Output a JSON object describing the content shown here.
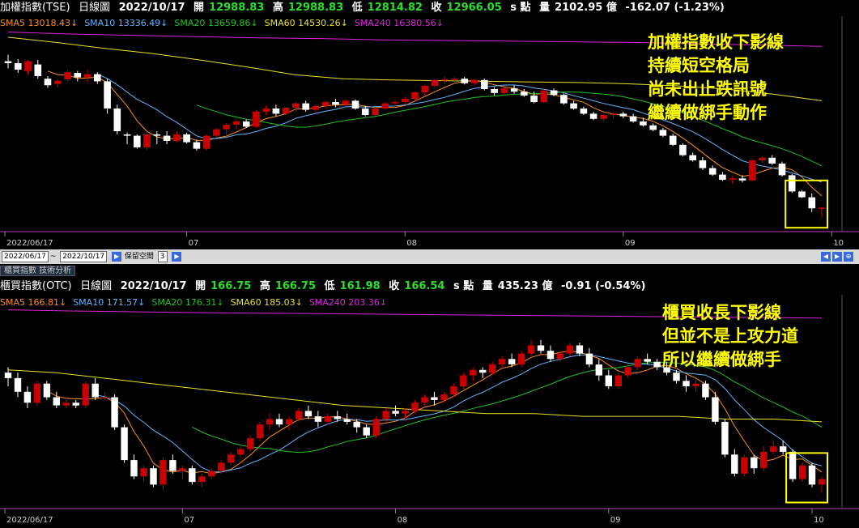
{
  "top": {
    "name": "加權指數(TSE)",
    "period": "日線圖",
    "date": "2022/10/17",
    "open_label": "開",
    "open": "12988.83",
    "high_label": "高",
    "high": "12988.83",
    "low_label": "低",
    "low": "12814.82",
    "close_label": "收",
    "close": "12966.05",
    "unit_label": "s 點",
    "vol_label": "量",
    "volume": "2102.95 億",
    "change": "-162.07 (-1.23%)",
    "legend": [
      {
        "label": "SMA5 13018.43",
        "color": "#ff8c1a"
      },
      {
        "label": "SMA10 13336.49",
        "color": "#5fb4ff"
      },
      {
        "label": "SMA20 13659.86",
        "color": "#22c022"
      },
      {
        "label": "SMA60 14530.26",
        "color": "#e8e020"
      },
      {
        "label": "SMA240 16380.56",
        "color": "#e020e0"
      }
    ],
    "annotation": [
      "加權指數收下影線",
      "持續短空格局",
      "尚未出止跌訊號",
      "繼續做綁手動作"
    ]
  },
  "bottom": {
    "name": "櫃買指數(OTC)",
    "period": "日線圖",
    "date": "2022/10/17",
    "open_label": "開",
    "open": "166.75",
    "high_label": "高",
    "high": "166.75",
    "low_label": "低",
    "low": "161.98",
    "close_label": "收",
    "close": "166.54",
    "unit_label": "s 點",
    "vol_label": "量",
    "volume": "435.23 億",
    "change": "-0.91 (-0.54%)",
    "legend": [
      {
        "label": "SMA5 166.81",
        "color": "#ff8c1a"
      },
      {
        "label": "SMA10 171.57",
        "color": "#5fb4ff"
      },
      {
        "label": "SMA20 176.31",
        "color": "#22c022"
      },
      {
        "label": "SMA60 185.03",
        "color": "#e8e020"
      },
      {
        "label": "SMA240 203.36",
        "color": "#e020e0"
      }
    ],
    "annotation": [
      "櫃買收長下影線",
      "但並不是上攻力道",
      "所以繼續做綁手"
    ]
  },
  "x_axis": [
    "2022/06/17",
    "07",
    "08",
    "09",
    "10"
  ],
  "toolbar": {
    "start": "2022/06/17",
    "end": "2022/10/17",
    "keep_label": "保留空間",
    "keep_value": "3"
  },
  "tab": {
    "label": "櫃買指數 技術分析"
  },
  "colors": {
    "up": "#c80000",
    "down": "#ffffff",
    "border": "#ffff00"
  },
  "chart_data": [
    {
      "type": "candlestick",
      "title": "加權指數(TSE)",
      "ylim": [
        12700,
        15700
      ],
      "ohlc": [
        [
          15230,
          15330,
          15120,
          15200
        ],
        [
          15200,
          15260,
          15050,
          15100
        ],
        [
          15080,
          15250,
          15020,
          15230
        ],
        [
          15180,
          15250,
          14960,
          15000
        ],
        [
          14960,
          15000,
          14820,
          14860
        ],
        [
          14880,
          14950,
          14820,
          14930
        ],
        [
          14950,
          15100,
          14920,
          15060
        ],
        [
          15050,
          15080,
          14920,
          14980
        ],
        [
          14980,
          15100,
          14900,
          15030
        ],
        [
          15030,
          15060,
          14880,
          14920
        ],
        [
          14920,
          14960,
          14420,
          14500
        ],
        [
          14500,
          14560,
          14100,
          14150
        ],
        [
          14100,
          14130,
          13950,
          14080
        ],
        [
          14080,
          14100,
          13880,
          13900
        ],
        [
          13900,
          14130,
          13860,
          14100
        ],
        [
          14100,
          14150,
          13950,
          14080
        ],
        [
          14080,
          14150,
          13950,
          14000
        ],
        [
          14000,
          14150,
          13980,
          14100
        ],
        [
          14100,
          14130,
          13960,
          13980
        ],
        [
          13980,
          14020,
          13850,
          13880
        ],
        [
          13880,
          14100,
          13850,
          14080
        ],
        [
          14080,
          14200,
          14050,
          14180
        ],
        [
          14180,
          14280,
          14100,
          14250
        ],
        [
          14250,
          14330,
          14180,
          14300
        ],
        [
          14300,
          14330,
          14200,
          14220
        ],
        [
          14220,
          14480,
          14200,
          14450
        ],
        [
          14450,
          14550,
          14400,
          14500
        ],
        [
          14500,
          14560,
          14380,
          14420
        ],
        [
          14420,
          14520,
          14400,
          14510
        ],
        [
          14510,
          14600,
          14450,
          14580
        ],
        [
          14580,
          14620,
          14450,
          14480
        ],
        [
          14480,
          14560,
          14440,
          14540
        ],
        [
          14540,
          14620,
          14500,
          14600
        ],
        [
          14600,
          14650,
          14520,
          14560
        ],
        [
          14560,
          14640,
          14540,
          14620
        ],
        [
          14620,
          14640,
          14480,
          14500
        ],
        [
          14500,
          14540,
          14380,
          14400
        ],
        [
          14400,
          14520,
          14380,
          14500
        ],
        [
          14500,
          14600,
          14480,
          14580
        ],
        [
          14580,
          14620,
          14520,
          14600
        ],
        [
          14600,
          14680,
          14560,
          14650
        ],
        [
          14650,
          14760,
          14620,
          14750
        ],
        [
          14750,
          14860,
          14700,
          14850
        ],
        [
          14850,
          14960,
          14820,
          14940
        ],
        [
          14940,
          15000,
          14880,
          14950
        ],
        [
          14950,
          14990,
          14900,
          14960
        ],
        [
          14960,
          14990,
          14870,
          14890
        ],
        [
          14890,
          14960,
          14850,
          14940
        ],
        [
          14940,
          14960,
          14780,
          14800
        ],
        [
          14800,
          14830,
          14700,
          14740
        ],
        [
          14740,
          14830,
          14720,
          14810
        ],
        [
          14810,
          14860,
          14730,
          14760
        ],
        [
          14760,
          14800,
          14680,
          14700
        ],
        [
          14700,
          14760,
          14580,
          14600
        ],
        [
          14600,
          14800,
          14580,
          14780
        ],
        [
          14780,
          14810,
          14690,
          14710
        ],
        [
          14710,
          14730,
          14560,
          14580
        ],
        [
          14580,
          14620,
          14480,
          14500
        ],
        [
          14500,
          14530,
          14400,
          14420
        ],
        [
          14420,
          14450,
          14320,
          14340
        ],
        [
          14340,
          14420,
          14300,
          14400
        ],
        [
          14400,
          14440,
          14340,
          14420
        ],
        [
          14420,
          14450,
          14350,
          14380
        ],
        [
          14380,
          14420,
          14280,
          14300
        ],
        [
          14300,
          14360,
          14220,
          14240
        ],
        [
          14240,
          14270,
          14150,
          14170
        ],
        [
          14170,
          14200,
          14060,
          14080
        ],
        [
          14080,
          14110,
          13920,
          13940
        ],
        [
          13940,
          13960,
          13760,
          13780
        ],
        [
          13780,
          13820,
          13680,
          13700
        ],
        [
          13700,
          13750,
          13550,
          13580
        ],
        [
          13580,
          13620,
          13460,
          13480
        ],
        [
          13480,
          13520,
          13380,
          13400
        ],
        [
          13400,
          13460,
          13340,
          13420
        ],
        [
          13420,
          13470,
          13360,
          13390
        ],
        [
          13390,
          13720,
          13370,
          13700
        ],
        [
          13700,
          13760,
          13660,
          13740
        ],
        [
          13740,
          13780,
          13630,
          13650
        ],
        [
          13650,
          13680,
          13450,
          13470
        ],
        [
          13470,
          13490,
          13200,
          13220
        ],
        [
          13220,
          13240,
          13120,
          13130
        ],
        [
          13130,
          13190,
          12900,
          12960
        ],
        [
          12960,
          12980,
          12810,
          12970
        ]
      ]
    },
    {
      "type": "candlestick",
      "title": "櫃買指數(OTC)",
      "ylim": [
        158,
        228
      ],
      "ohlc": [
        [
          206,
          208,
          201,
          204
        ],
        [
          204,
          206,
          197,
          199
        ],
        [
          199,
          201,
          193,
          195
        ],
        [
          195,
          203,
          194,
          202
        ],
        [
          202,
          203,
          196,
          197
        ],
        [
          197,
          199,
          193,
          194
        ],
        [
          194,
          197,
          193,
          195
        ],
        [
          195,
          196,
          193,
          194
        ],
        [
          194,
          203,
          193,
          202
        ],
        [
          202,
          204,
          196,
          197
        ],
        [
          197,
          199,
          196,
          197
        ],
        [
          197,
          198,
          185,
          186
        ],
        [
          186,
          187,
          173,
          174
        ],
        [
          174,
          176,
          167,
          168
        ],
        [
          168,
          172,
          166,
          171
        ],
        [
          171,
          172,
          164,
          165
        ],
        [
          165,
          175,
          163,
          174
        ],
        [
          174,
          176,
          169,
          170
        ],
        [
          170,
          172,
          167,
          171
        ],
        [
          171,
          172,
          165,
          166
        ],
        [
          166,
          169,
          164,
          168
        ],
        [
          168,
          171,
          167,
          170
        ],
        [
          170,
          174,
          169,
          173
        ],
        [
          173,
          177,
          172,
          176
        ],
        [
          176,
          179,
          175,
          178
        ],
        [
          178,
          183,
          177,
          182
        ],
        [
          182,
          188,
          181,
          187
        ],
        [
          187,
          191,
          185,
          189
        ],
        [
          189,
          191,
          186,
          187
        ],
        [
          187,
          190,
          185,
          189
        ],
        [
          189,
          193,
          188,
          192
        ],
        [
          192,
          194,
          189,
          190
        ],
        [
          190,
          192,
          186,
          188
        ],
        [
          188,
          191,
          187,
          190
        ],
        [
          190,
          192,
          188,
          189
        ],
        [
          189,
          191,
          187,
          188
        ],
        [
          188,
          189,
          184,
          186
        ],
        [
          186,
          187,
          182,
          183
        ],
        [
          183,
          190,
          182,
          189
        ],
        [
          189,
          193,
          188,
          192
        ],
        [
          192,
          194,
          190,
          191
        ],
        [
          191,
          193,
          189,
          192
        ],
        [
          192,
          196,
          191,
          195
        ],
        [
          195,
          198,
          194,
          197
        ],
        [
          197,
          199,
          194,
          196
        ],
        [
          196,
          199,
          195,
          198
        ],
        [
          198,
          202,
          197,
          201
        ],
        [
          201,
          206,
          200,
          205
        ],
        [
          205,
          208,
          203,
          207
        ],
        [
          207,
          208,
          204,
          206
        ],
        [
          206,
          210,
          205,
          209
        ],
        [
          209,
          212,
          208,
          211
        ],
        [
          211,
          213,
          208,
          209
        ],
        [
          209,
          214,
          208,
          213
        ],
        [
          213,
          218,
          212,
          216
        ],
        [
          216,
          218,
          213,
          214
        ],
        [
          214,
          216,
          210,
          211
        ],
        [
          211,
          214,
          210,
          213
        ],
        [
          213,
          217,
          212,
          216
        ],
        [
          216,
          217,
          212,
          213
        ],
        [
          213,
          215,
          208,
          209
        ],
        [
          209,
          211,
          203,
          205
        ],
        [
          205,
          207,
          200,
          201
        ],
        [
          201,
          206,
          200,
          205
        ],
        [
          205,
          209,
          204,
          208
        ],
        [
          208,
          212,
          207,
          211
        ],
        [
          211,
          213,
          209,
          210
        ],
        [
          210,
          211,
          207,
          208
        ],
        [
          208,
          210,
          205,
          206
        ],
        [
          206,
          207,
          202,
          203
        ],
        [
          203,
          205,
          199,
          201
        ],
        [
          201,
          204,
          199,
          202
        ],
        [
          202,
          203,
          196,
          197
        ],
        [
          197,
          199,
          187,
          188
        ],
        [
          188,
          189,
          175,
          176
        ],
        [
          176,
          178,
          168,
          169
        ],
        [
          169,
          176,
          168,
          175
        ],
        [
          175,
          176,
          169,
          171
        ],
        [
          171,
          179,
          170,
          177
        ],
        [
          177,
          181,
          176,
          179
        ],
        [
          179,
          181,
          176,
          177
        ],
        [
          177,
          178,
          166,
          167
        ],
        [
          167,
          173,
          166,
          172
        ],
        [
          172,
          173,
          164,
          165
        ],
        [
          165,
          168,
          162,
          167
        ]
      ]
    }
  ]
}
